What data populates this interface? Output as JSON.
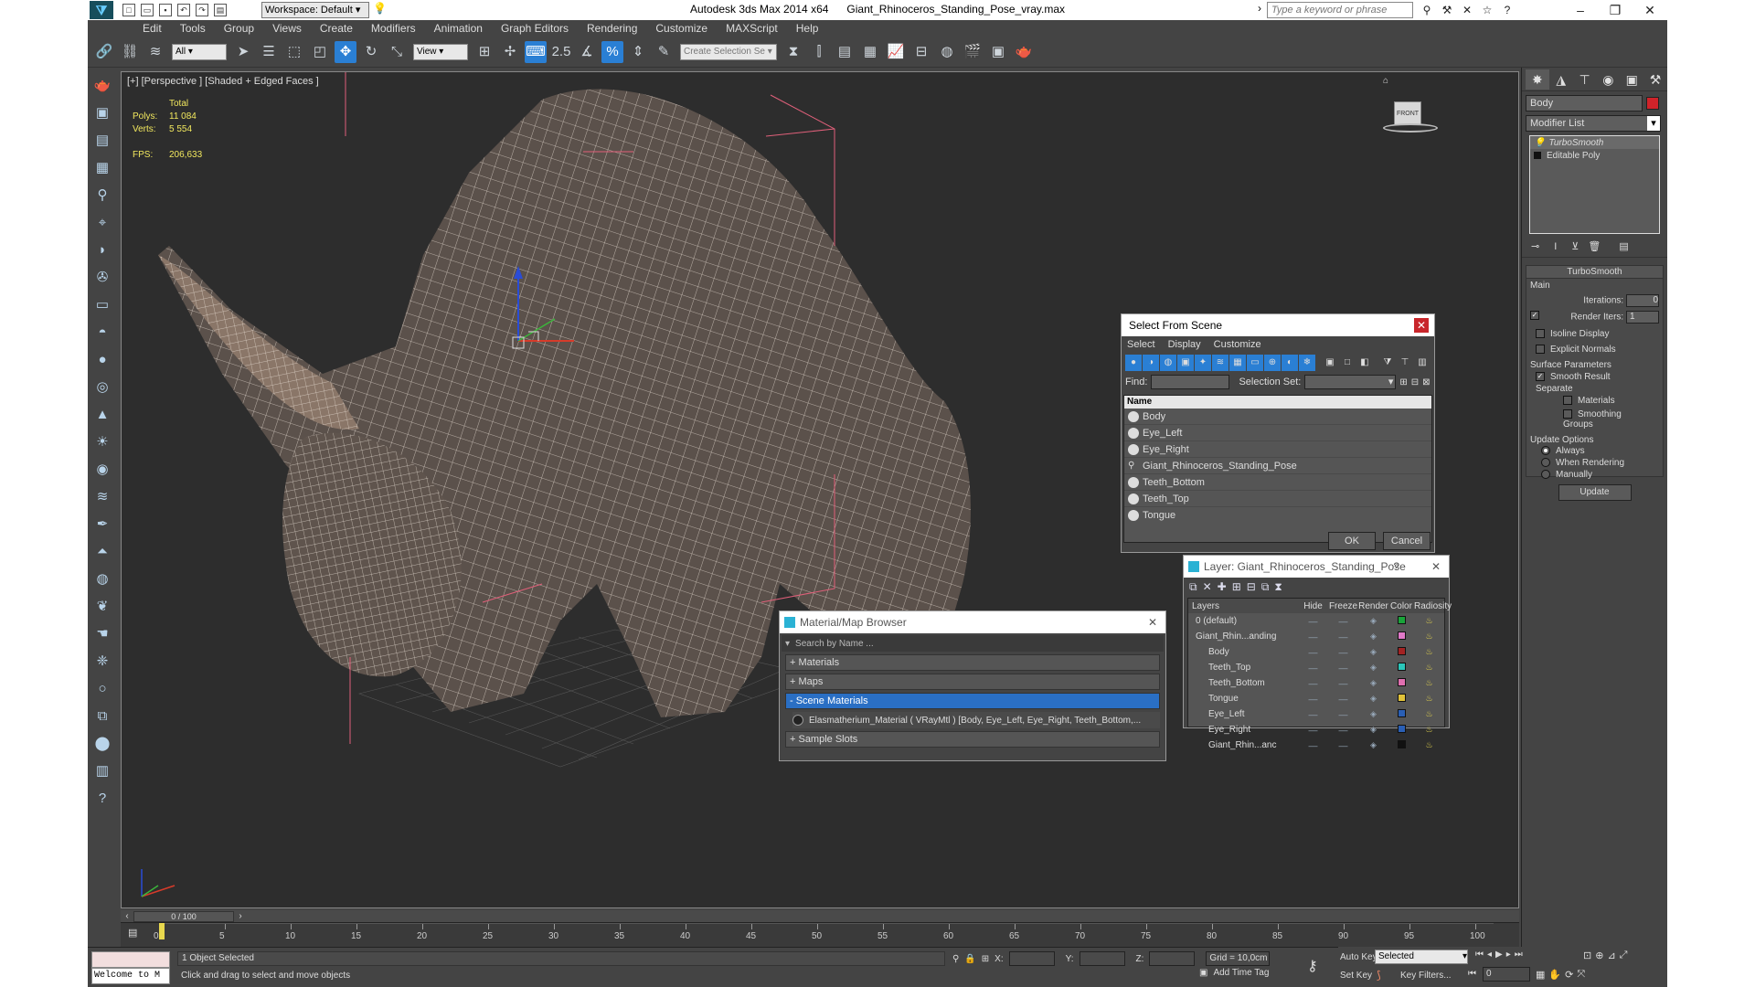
{
  "window": {
    "app_title": "Autodesk 3ds Max 2014 x64",
    "file_name": "Giant_Rhinoceros_Standing_Pose_vray.max",
    "workspace": "Workspace: Default",
    "search_placeholder": "Type a keyword or phrase"
  },
  "menu": [
    "Edit",
    "Tools",
    "Group",
    "Views",
    "Create",
    "Modifiers",
    "Animation",
    "Graph Editors",
    "Rendering",
    "Customize",
    "MAXScript",
    "Help"
  ],
  "toolbar": {
    "selection_filter": "All",
    "ref_coord": "View",
    "named_selection_placeholder": "Create Selection Se",
    "snap_label": "2.5",
    "percent_snap": "%"
  },
  "viewport": {
    "label": "[+] [Perspective ] [Shaded + Edged Faces ]",
    "stats_header": "Total",
    "polys_label": "Polys:",
    "polys_value": "11 084",
    "verts_label": "Verts:",
    "verts_value": "5 554",
    "fps_label": "FPS:",
    "fps_value": "206,633",
    "viewcube_label": "FRONT"
  },
  "select_from_scene": {
    "title": "Select From Scene",
    "tabs": [
      "Select",
      "Display",
      "Customize"
    ],
    "find_label": "Find:",
    "selection_set_label": "Selection Set:",
    "column_name": "Name",
    "items": [
      "Body",
      "Eye_Left",
      "Eye_Right",
      "Giant_Rhinoceros_Standing_Pose",
      "Teeth_Bottom",
      "Teeth_Top",
      "Tongue"
    ],
    "ok": "OK",
    "cancel": "Cancel"
  },
  "layer_dialog": {
    "title": "Layer: Giant_Rhinoceros_Standing_Pose",
    "help": "?",
    "columns": [
      "Layers",
      "Hide",
      "Freeze",
      "Render",
      "Color",
      "Radiosity"
    ],
    "rows": [
      {
        "name": "0 (default)",
        "color": "#1aa43a"
      },
      {
        "name": "Giant_Rhin...anding",
        "color": "#e079c8"
      },
      {
        "name": "Body",
        "color": "#a32323"
      },
      {
        "name": "Teeth_Top",
        "color": "#2bc6b9"
      },
      {
        "name": "Teeth_Bottom",
        "color": "#e06fb0"
      },
      {
        "name": "Tongue",
        "color": "#e0c23a"
      },
      {
        "name": "Eye_Left",
        "color": "#2a5fb5"
      },
      {
        "name": "Eye_Right",
        "color": "#2a5fb5"
      },
      {
        "name": "Giant_Rhin...anc",
        "color": "#111111"
      }
    ]
  },
  "material_browser": {
    "title": "Material/Map Browser",
    "search_placeholder": "Search by Name ...",
    "groups": [
      "+ Materials",
      "+ Maps",
      "- Scene Materials"
    ],
    "material_entry": "Elasmatherium_Material  ( VRayMtl ) [Body, Eye_Left, Eye_Right, Teeth_Bottom,...",
    "sample_slots": "+ Sample Slots"
  },
  "command_panel": {
    "object_name": "Body",
    "object_color": "#d0232a",
    "modifier_list": "Modifier List",
    "stack": [
      "TurboSmooth",
      "Editable Poly"
    ],
    "rollout_title": "TurboSmooth",
    "main_label": "Main",
    "iterations_label": "Iterations:",
    "iterations_value": "0",
    "render_iters_label": "Render Iters:",
    "render_iters_value": "1",
    "isoline": "Isoline Display",
    "explicit_normals": "Explicit Normals",
    "surface_params": "Surface Parameters",
    "smooth_result": "Smooth Result",
    "separate": "Separate",
    "materials": "Materials",
    "smoothing_groups": "Smoothing Groups",
    "update_options": "Update Options",
    "always": "Always",
    "when_rendering": "When Rendering",
    "manually": "Manually",
    "update_btn": "Update"
  },
  "timeline": {
    "frame_counter": "0 / 100",
    "ticks": [
      "0",
      "5",
      "10",
      "15",
      "20",
      "25",
      "30",
      "35",
      "40",
      "45",
      "50",
      "55",
      "60",
      "65",
      "70",
      "75",
      "80",
      "85",
      "90",
      "95",
      "100"
    ]
  },
  "status": {
    "script_listener": "Welcome to M",
    "objects_selected": "1 Object Selected",
    "prompt": "Click and drag to select and move objects",
    "x_label": "X:",
    "y_label": "Y:",
    "z_label": "Z:",
    "grid": "Grid = 10,0cm",
    "add_time_tag": "Add Time Tag",
    "auto_key": "Auto Key",
    "set_key": "Set Key",
    "selected_dropdown": "Selected",
    "key_filters": "Key Filters...",
    "frame_value": "0"
  }
}
